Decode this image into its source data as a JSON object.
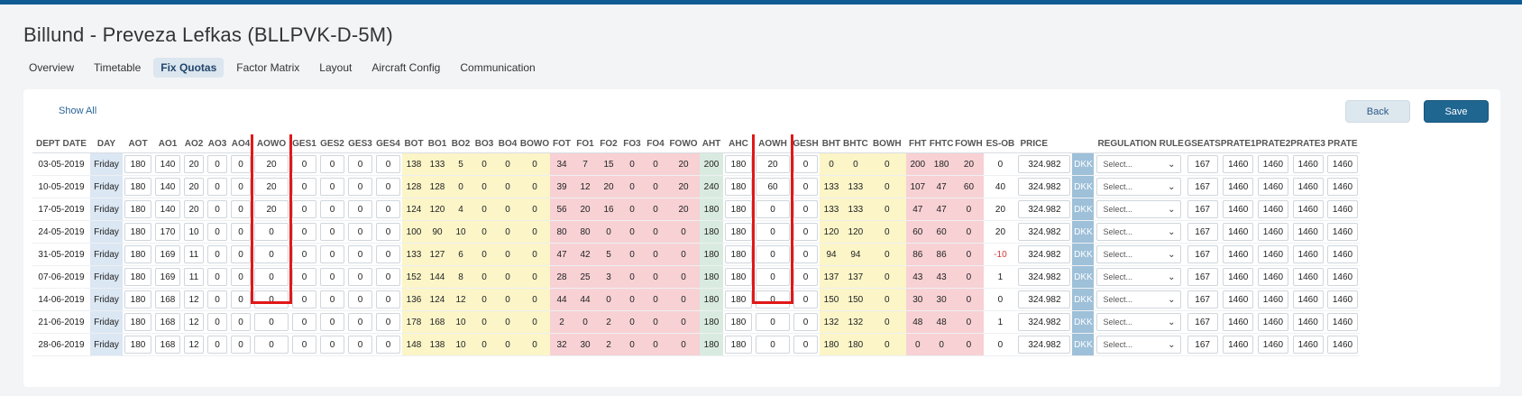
{
  "page": {
    "title": "Billund - Preveza Lefkas (BLLPVK-D-5M)",
    "tabs": [
      "Overview",
      "Timetable",
      "Fix Quotas",
      "Factor Matrix",
      "Layout",
      "Aircraft Config",
      "Communication"
    ],
    "active_tab": "Fix Quotas"
  },
  "toolbar": {
    "show_all": "Show All",
    "back": "Back",
    "save": "Save"
  },
  "columns": [
    {
      "label": "DEPT DATE",
      "type": "date"
    },
    {
      "label": "DAY",
      "type": "day"
    },
    {
      "label": "AOT",
      "type": "inp",
      "bg": "w"
    },
    {
      "label": "AO1",
      "type": "inp",
      "bg": "w"
    },
    {
      "label": "AO2",
      "type": "inp",
      "bg": "w"
    },
    {
      "label": "AO3",
      "type": "inp",
      "bg": "w"
    },
    {
      "label": "AO4",
      "type": "inp",
      "bg": "w"
    },
    {
      "label": "AOWO",
      "type": "inp",
      "bg": "w"
    },
    {
      "label": "GES1",
      "type": "inp",
      "bg": "w"
    },
    {
      "label": "GES2",
      "type": "inp",
      "bg": "w"
    },
    {
      "label": "GES3",
      "type": "inp",
      "bg": "w"
    },
    {
      "label": "GES4",
      "type": "inp",
      "bg": "w"
    },
    {
      "label": "BOT",
      "type": "txt",
      "bg": "y"
    },
    {
      "label": "BO1",
      "type": "txt",
      "bg": "y"
    },
    {
      "label": "BO2",
      "type": "txt",
      "bg": "y"
    },
    {
      "label": "BO3",
      "type": "txt",
      "bg": "y"
    },
    {
      "label": "BO4",
      "type": "txt",
      "bg": "y"
    },
    {
      "label": "BOWO",
      "type": "txt",
      "bg": "y"
    },
    {
      "label": "FOT",
      "type": "txt",
      "bg": "p"
    },
    {
      "label": "FO1",
      "type": "txt",
      "bg": "p"
    },
    {
      "label": "FO2",
      "type": "txt",
      "bg": "p"
    },
    {
      "label": "FO3",
      "type": "txt",
      "bg": "p"
    },
    {
      "label": "FO4",
      "type": "txt",
      "bg": "p"
    },
    {
      "label": "FOWO",
      "type": "txt",
      "bg": "p"
    },
    {
      "label": "AHT",
      "type": "txt",
      "bg": "g"
    },
    {
      "label": "AHC",
      "type": "inp",
      "bg": "w"
    },
    {
      "label": "AOWH",
      "type": "inp",
      "bg": "w"
    },
    {
      "label": "GESH",
      "type": "inp",
      "bg": "w"
    },
    {
      "label": "BHT",
      "type": "txt",
      "bg": "y"
    },
    {
      "label": "BHTC",
      "type": "txt",
      "bg": "y"
    },
    {
      "label": "BOWH",
      "type": "txt",
      "bg": "y"
    },
    {
      "label": "FHT",
      "type": "txt",
      "bg": "p"
    },
    {
      "label": "FHTC",
      "type": "txt",
      "bg": "p"
    },
    {
      "label": "FOWH",
      "type": "txt",
      "bg": "p"
    },
    {
      "label": "ES-OB",
      "type": "txt",
      "bg": "w"
    },
    {
      "label": "PRICE",
      "type": "inp",
      "bg": "w"
    },
    {
      "label": "",
      "type": "cur"
    },
    {
      "label": "REGULATION RULE",
      "type": "sel"
    },
    {
      "label": "GSEATS",
      "type": "inp",
      "bg": "w"
    },
    {
      "label": "PRATE1",
      "type": "inp",
      "bg": "w"
    },
    {
      "label": "PRATE2",
      "type": "inp",
      "bg": "w"
    },
    {
      "label": "PRATE3",
      "type": "inp",
      "bg": "w"
    },
    {
      "label": "PRATE",
      "type": "inp",
      "bg": "w"
    }
  ],
  "rows": [
    [
      "03-05-2019",
      "Friday",
      "180",
      "140",
      "20",
      "0",
      "0",
      "20",
      "0",
      "0",
      "0",
      "0",
      "138",
      "133",
      "5",
      "0",
      "0",
      "0",
      "34",
      "7",
      "15",
      "0",
      "0",
      "20",
      "200",
      "180",
      "20",
      "0",
      "0",
      "0",
      "0",
      "200",
      "180",
      "20",
      "0",
      "324.982",
      "DKK",
      "Select...",
      "167",
      "1460",
      "1460",
      "1460",
      "1460"
    ],
    [
      "10-05-2019",
      "Friday",
      "180",
      "140",
      "20",
      "0",
      "0",
      "20",
      "0",
      "0",
      "0",
      "0",
      "128",
      "128",
      "0",
      "0",
      "0",
      "0",
      "39",
      "12",
      "20",
      "0",
      "0",
      "20",
      "240",
      "180",
      "60",
      "0",
      "133",
      "133",
      "0",
      "107",
      "47",
      "60",
      "40",
      "324.982",
      "DKK",
      "Select...",
      "167",
      "1460",
      "1460",
      "1460",
      "1460"
    ],
    [
      "17-05-2019",
      "Friday",
      "180",
      "140",
      "20",
      "0",
      "0",
      "20",
      "0",
      "0",
      "0",
      "0",
      "124",
      "120",
      "4",
      "0",
      "0",
      "0",
      "56",
      "20",
      "16",
      "0",
      "0",
      "20",
      "180",
      "180",
      "0",
      "0",
      "133",
      "133",
      "0",
      "47",
      "47",
      "0",
      "20",
      "324.982",
      "DKK",
      "Select...",
      "167",
      "1460",
      "1460",
      "1460",
      "1460"
    ],
    [
      "24-05-2019",
      "Friday",
      "180",
      "170",
      "10",
      "0",
      "0",
      "0",
      "0",
      "0",
      "0",
      "0",
      "100",
      "90",
      "10",
      "0",
      "0",
      "0",
      "80",
      "80",
      "0",
      "0",
      "0",
      "0",
      "180",
      "180",
      "0",
      "0",
      "120",
      "120",
      "0",
      "60",
      "60",
      "0",
      "20",
      "324.982",
      "DKK",
      "Select...",
      "167",
      "1460",
      "1460",
      "1460",
      "1460"
    ],
    [
      "31-05-2019",
      "Friday",
      "180",
      "169",
      "11",
      "0",
      "0",
      "0",
      "0",
      "0",
      "0",
      "0",
      "133",
      "127",
      "6",
      "0",
      "0",
      "0",
      "47",
      "42",
      "5",
      "0",
      "0",
      "0",
      "180",
      "180",
      "0",
      "0",
      "94",
      "94",
      "0",
      "86",
      "86",
      "0",
      "-10",
      "324.982",
      "DKK",
      "Select...",
      "167",
      "1460",
      "1460",
      "1460",
      "1460"
    ],
    [
      "07-06-2019",
      "Friday",
      "180",
      "169",
      "11",
      "0",
      "0",
      "0",
      "0",
      "0",
      "0",
      "0",
      "152",
      "144",
      "8",
      "0",
      "0",
      "0",
      "28",
      "25",
      "3",
      "0",
      "0",
      "0",
      "180",
      "180",
      "0",
      "0",
      "137",
      "137",
      "0",
      "43",
      "43",
      "0",
      "1",
      "324.982",
      "DKK",
      "Select...",
      "167",
      "1460",
      "1460",
      "1460",
      "1460"
    ],
    [
      "14-06-2019",
      "Friday",
      "180",
      "168",
      "12",
      "0",
      "0",
      "0",
      "0",
      "0",
      "0",
      "0",
      "136",
      "124",
      "12",
      "0",
      "0",
      "0",
      "44",
      "44",
      "0",
      "0",
      "0",
      "0",
      "180",
      "180",
      "0",
      "0",
      "150",
      "150",
      "0",
      "30",
      "30",
      "0",
      "0",
      "324.982",
      "DKK",
      "Select...",
      "167",
      "1460",
      "1460",
      "1460",
      "1460"
    ],
    [
      "21-06-2019",
      "Friday",
      "180",
      "168",
      "12",
      "0",
      "0",
      "0",
      "0",
      "0",
      "0",
      "0",
      "178",
      "168",
      "10",
      "0",
      "0",
      "0",
      "2",
      "0",
      "2",
      "0",
      "0",
      "0",
      "180",
      "180",
      "0",
      "0",
      "132",
      "132",
      "0",
      "48",
      "48",
      "0",
      "1",
      "324.982",
      "DKK",
      "Select...",
      "167",
      "1460",
      "1460",
      "1460",
      "1460"
    ],
    [
      "28-06-2019",
      "Friday",
      "180",
      "168",
      "12",
      "0",
      "0",
      "0",
      "0",
      "0",
      "0",
      "0",
      "148",
      "138",
      "10",
      "0",
      "0",
      "0",
      "32",
      "30",
      "2",
      "0",
      "0",
      "0",
      "180",
      "180",
      "0",
      "0",
      "180",
      "180",
      "0",
      "0",
      "0",
      "0",
      "0",
      "324.982",
      "DKK",
      "Select...",
      "167",
      "1460",
      "1460",
      "1460",
      "1460"
    ]
  ],
  "highlights": [
    "AOWO",
    "AOWH"
  ],
  "colors": {
    "header_bar": "#0f5b93",
    "yellow": "#fbf5c8",
    "pink": "#f7d1d4",
    "green": "#d9ebe0",
    "blue": "#dbe7f3",
    "highlight": "#e01818",
    "negative": "#d53a3a"
  }
}
